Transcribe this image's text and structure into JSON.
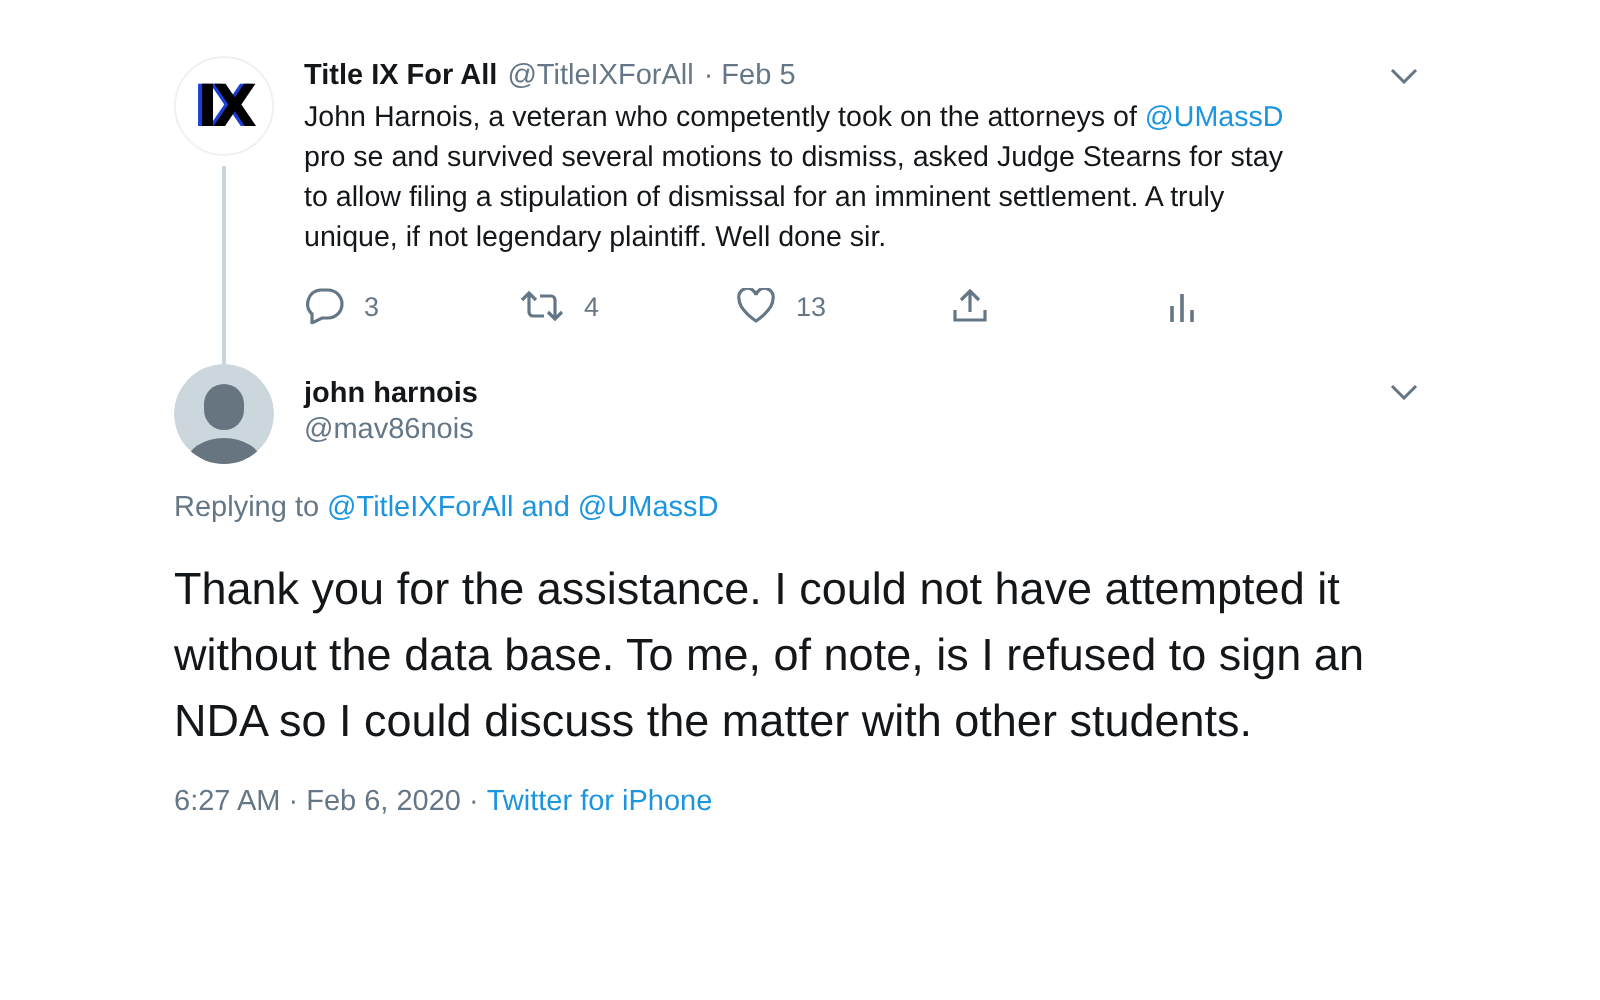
{
  "parent_tweet": {
    "avatar_logo": "IX",
    "name": "Title IX For All",
    "handle": "@TitleIXForAll",
    "date": "· Feb 5",
    "text": [
      {
        "kind": "text",
        "text": "John Harnois, a veteran who competently took on the attorneys of "
      },
      {
        "kind": "mention",
        "text": "@UMassD"
      },
      {
        "kind": "text",
        "text": " pro se and survived several motions to dismiss, asked Judge Stearns for stay to allow filing a stipulation of dismissal for an imminent settlement. A truly unique, if not legendary plaintiff. Well done sir."
      }
    ],
    "actions": [
      {
        "kind": "reply",
        "count": "3"
      },
      {
        "kind": "retweet",
        "count": "4"
      },
      {
        "kind": "like",
        "count": "13"
      },
      {
        "kind": "share"
      },
      {
        "kind": "analytics"
      }
    ]
  },
  "reply_tweet": {
    "name": "john harnois",
    "handle": "@mav86nois",
    "replying_to": {
      "prefix": "Replying to",
      "mentions": "@TitleIXForAll and @UMassD"
    },
    "text": "Thank you for the assistance. I could not have attempted it without the data base. To me, of note, is I refused to sign an NDA so I could discuss the matter with other students.",
    "timestamp": "6:27 AM · Feb 6, 2020 ·",
    "source": "Twitter for iPhone"
  }
}
